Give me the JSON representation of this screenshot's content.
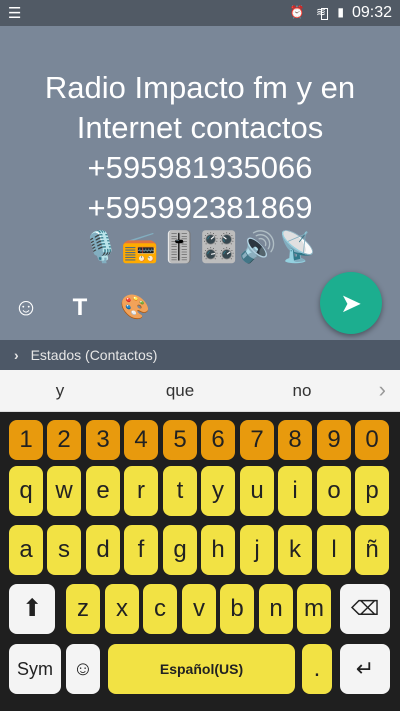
{
  "status_bar": {
    "notification_icon": "notification-icon",
    "time": "09:32"
  },
  "compose": {
    "message_lines": [
      "Radio Impacto fm y en",
      "Internet contactos",
      "+595981935066",
      "+595992381869"
    ],
    "emoji_line": "🎙️📻🎚️🎛️🔊📡"
  },
  "status_strip": {
    "label": "Estados (Contactos)"
  },
  "suggestions": [
    "y",
    "que",
    "no"
  ],
  "keyboard": {
    "numbers": [
      "1",
      "2",
      "3",
      "4",
      "5",
      "6",
      "7",
      "8",
      "9",
      "0"
    ],
    "row1": [
      "q",
      "w",
      "e",
      "r",
      "t",
      "y",
      "u",
      "i",
      "o",
      "p"
    ],
    "row2": [
      "a",
      "s",
      "d",
      "f",
      "g",
      "h",
      "j",
      "k",
      "l",
      "ñ"
    ],
    "row3": [
      "z",
      "x",
      "c",
      "v",
      "b",
      "n",
      "m"
    ],
    "sym": "Sym",
    "space": "Español(US)",
    "period": "."
  }
}
